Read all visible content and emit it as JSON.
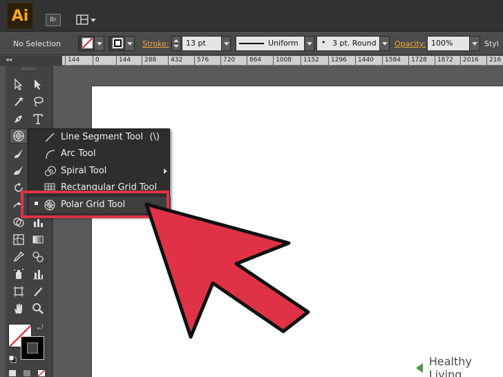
{
  "app": {
    "logo": "Ai",
    "bridge_label": "Br"
  },
  "controlbar": {
    "selection": "No Selection",
    "stroke_label": "Stroke:",
    "stroke_weight": "13 pt",
    "profile": "Uniform",
    "brush": "3 pt. Round",
    "opacity_label": "Opacity:",
    "opacity": "100%",
    "style_label": "Styl"
  },
  "ruler": [
    "144",
    "0",
    "144",
    "288",
    "432",
    "576",
    "720",
    "864",
    "1008",
    "1152",
    "1296",
    "1440",
    "1584",
    "1728",
    "1872",
    "2016",
    "216"
  ],
  "flyout": {
    "items": [
      {
        "label": "Line Segment Tool",
        "shortcut": "(\\)"
      },
      {
        "label": "Arc Tool",
        "shortcut": ""
      },
      {
        "label": "Spiral Tool",
        "shortcut": ""
      },
      {
        "label": "Rectangular Grid Tool",
        "shortcut": ""
      },
      {
        "label": "Polar Grid Tool",
        "shortcut": ""
      }
    ]
  },
  "colors": {
    "accent": "#f0a63c",
    "highlight": "#e03246",
    "arrow": "#e03246",
    "logo": "#f7a81b"
  },
  "watermark": "Healthy Living"
}
